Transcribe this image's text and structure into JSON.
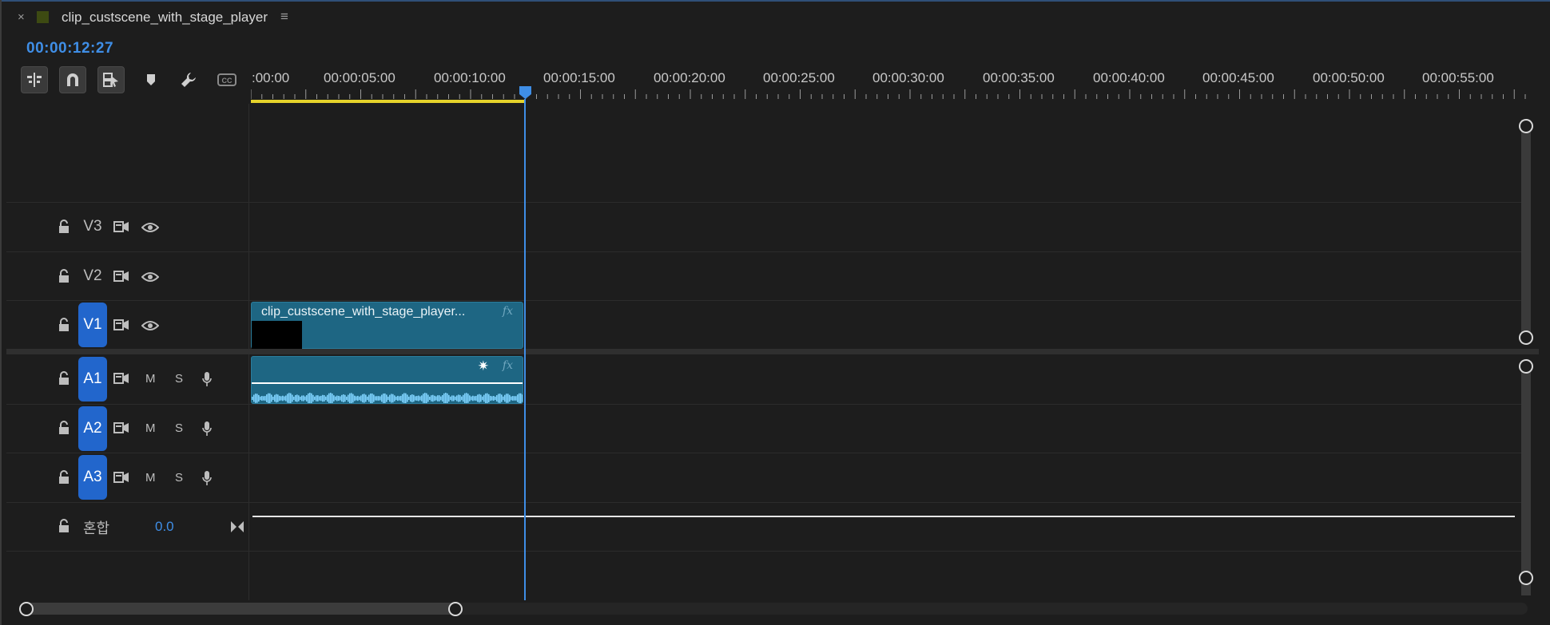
{
  "tab": {
    "close": "×",
    "title": "clip_custscene_with_stage_player",
    "menu": "≡",
    "swatch_color": "#3d4a12"
  },
  "timecode": "00:00:12:27",
  "toolbar": [
    {
      "icon": "insert-sequence-nest-icon",
      "active": true
    },
    {
      "icon": "snap-magnet-icon",
      "active": true
    },
    {
      "icon": "linked-selection-icon",
      "active": true
    },
    {
      "icon": "add-marker-icon",
      "active": false
    },
    {
      "icon": "wrench-settings-icon",
      "active": false
    },
    {
      "icon": "captions-icon",
      "active": false
    }
  ],
  "ruler": {
    "labels": [
      ":00:00",
      "00:00:05:00",
      "00:00:10:00",
      "00:00:15:00",
      "00:00:20:00",
      "00:00:25:00",
      "00:00:30:00",
      "00:00:35:00",
      "00:00:40:00",
      "00:00:45:00",
      "00:00:50:00",
      "00:00:55:00"
    ],
    "in_out_color": "#e6d32b",
    "playhead_color": "#3f8ee6"
  },
  "tracks": {
    "video": [
      {
        "label": "V3",
        "active": false
      },
      {
        "label": "V2",
        "active": false
      },
      {
        "label": "V1",
        "active": true
      }
    ],
    "audio": [
      {
        "label": "A1",
        "mute": "M",
        "solo": "S"
      },
      {
        "label": "A2",
        "mute": "M",
        "solo": "S"
      },
      {
        "label": "A3",
        "mute": "M",
        "solo": "S"
      }
    ],
    "mix": {
      "label": "혼합",
      "value": "0.0"
    }
  },
  "clips": {
    "video": {
      "name": "clip_custscene_with_stage_player...",
      "fx": "fx",
      "color": "#1e6683"
    },
    "audio": {
      "fx": "fx",
      "keyframe": "✷",
      "color": "#1e6683"
    }
  },
  "accent_color": "#2266cc"
}
